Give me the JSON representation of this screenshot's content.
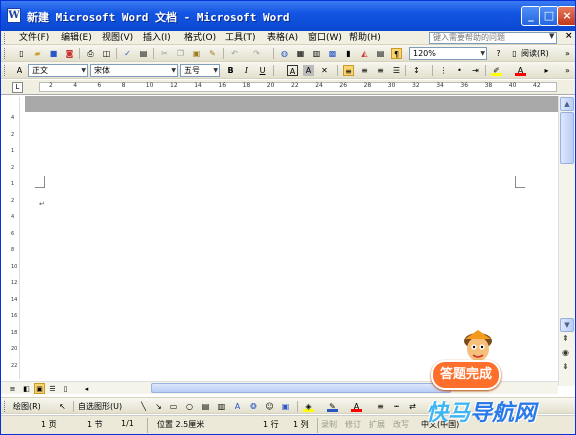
{
  "window": {
    "title": "新建 Microsoft Word 文档 - Microsoft Word",
    "minimize": "_",
    "maximize": "□",
    "close": "×"
  },
  "menu": {
    "items": [
      "文件(F)",
      "编辑(E)",
      "视图(V)",
      "插入(I)",
      "格式(O)",
      "工具(T)",
      "表格(A)",
      "窗口(W)",
      "帮助(H)"
    ],
    "help_placeholder": "键入需要帮助的问题",
    "close_doc": "×"
  },
  "standard_toolbar": {
    "zoom": "120%",
    "read_label": "阅读(R)"
  },
  "format_toolbar": {
    "style": "正文",
    "font": "宋体",
    "size": "五号",
    "bold": "B",
    "italic": "I",
    "underline": "U",
    "char_border": "A",
    "char_shading": "A"
  },
  "ruler": {
    "mode": "L",
    "ticks": [
      "2",
      "4",
      "6",
      "8",
      "10",
      "12",
      "14",
      "16",
      "18",
      "20",
      "22",
      "24",
      "26",
      "28",
      "30",
      "32",
      "34",
      "36",
      "38",
      "40",
      "42"
    ]
  },
  "vruler_ticks": [
    "4",
    "2",
    "1",
    "2",
    "1",
    "2",
    "4",
    "6",
    "8",
    "10",
    "12",
    "14",
    "16",
    "18",
    "20",
    "22"
  ],
  "document": {
    "paragraph_mark": "↵"
  },
  "drawing_toolbar": {
    "draw_label": "绘图(R)",
    "autoshapes_label": "自选图形(U)"
  },
  "statusbar": {
    "page": "1 页",
    "section": "1 节",
    "pages": "1/1",
    "position": "位置 2.5厘米",
    "line": "1 行",
    "column": "1 列",
    "rec": "录制",
    "trk": "修订",
    "ext": "扩展",
    "ovr": "改写",
    "lang": "中文(中国)"
  },
  "overlay": {
    "badge": "答题完成",
    "watermark_a": "快马",
    "watermark_b": "导航网"
  },
  "colors": {
    "titlebar": "#0b48d0",
    "toolbar": "#e3e0cd",
    "badge": "#ff6f2c",
    "watermark": "#2b79e8"
  }
}
